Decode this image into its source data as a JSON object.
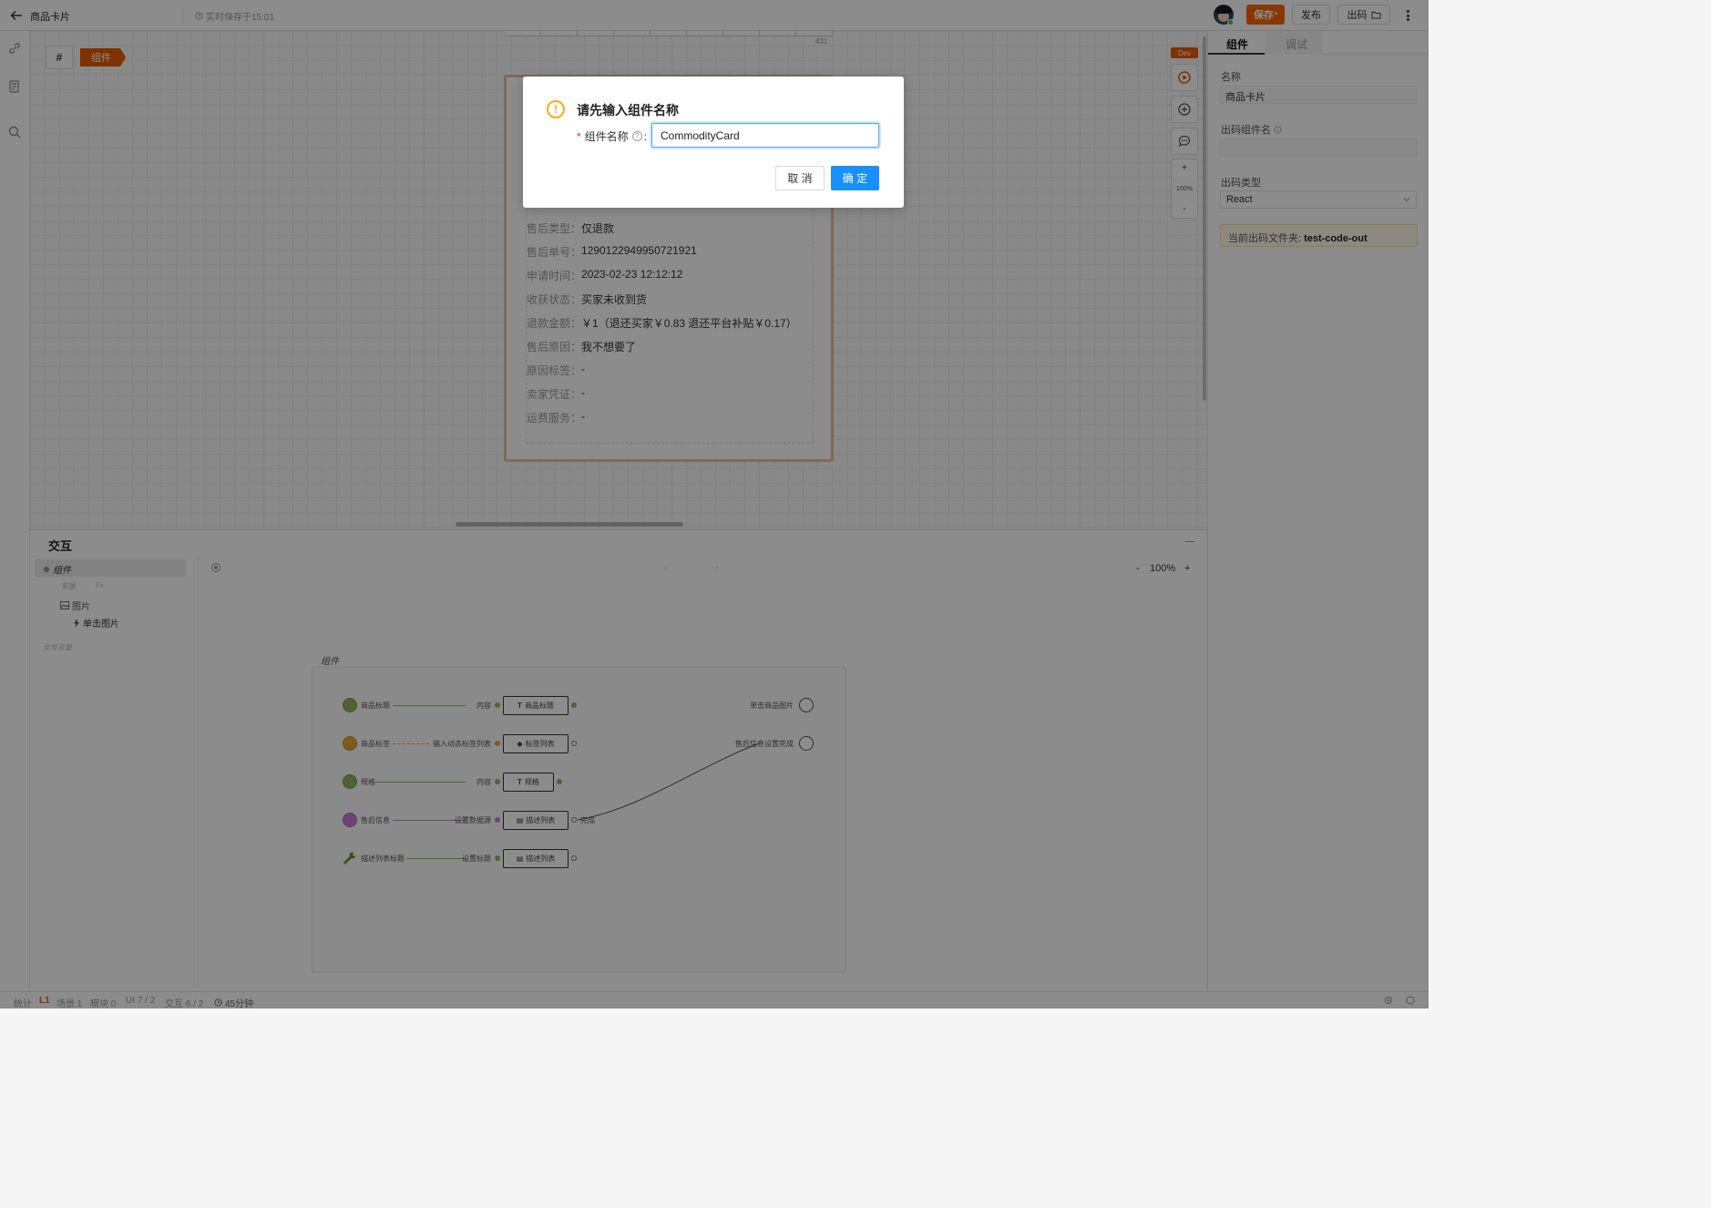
{
  "topbar": {
    "title": "商品卡片",
    "save_status": "实时保存于15:01",
    "save_label": "保存",
    "save_mark": "*",
    "publish_label": "发布",
    "code_label": "出码"
  },
  "canvas": {
    "hash_label": "#",
    "component_tag": "组件",
    "ruler_number": "431",
    "dev_badge": "Dev",
    "zoom_plus": "+",
    "zoom_level": "100%",
    "zoom_minus": "-",
    "descriptions": [
      {
        "key": "售后类型：",
        "value": "仅退款"
      },
      {
        "key": "售后单号：",
        "value": "1290122949950721921"
      },
      {
        "key": "申请时间：",
        "value": "2023-02-23 12:12:12"
      },
      {
        "key": "收获状态：",
        "value": "买家未收到货"
      },
      {
        "key": "退款金额：",
        "value": "￥1（退还买家￥0.83 退还平台补贴￥0.17）"
      },
      {
        "key": "售后原因：",
        "value": "我不想要了"
      },
      {
        "key": "原因标签：",
        "value": "-"
      },
      {
        "key": "卖家凭证：",
        "value": "-"
      },
      {
        "key": "运费服务：",
        "value": "-"
      }
    ]
  },
  "right_panel": {
    "tabs": [
      "组件",
      "调试"
    ],
    "name_label": "名称",
    "name_value": "商品卡片",
    "code_name_label": "出码组件名",
    "code_name_value": "",
    "code_type_label": "出码类型",
    "code_type_value": "React",
    "notice_prefix": "当前出码文件夹: ",
    "notice_folder": "test-code-out"
  },
  "interaction": {
    "title": "交互",
    "tree": {
      "root": "组件",
      "sub1": "变量",
      "sub2": "Fx",
      "image": "图片",
      "click": "单击图片",
      "global": "全局变量"
    },
    "nav": "← →",
    "zoom_minus": "-",
    "zoom_level": "100%",
    "zoom_plus": "+",
    "frame_label": "组件",
    "graph": {
      "inputs": [
        "商品标题",
        "商品标签",
        "规格",
        "售后信息",
        "描述列表标题"
      ],
      "port_labels": [
        "内容",
        "输入动态标签列表",
        "内容",
        "设置数据源",
        "设置标题"
      ],
      "boxes": [
        "商品标题",
        "标签列表",
        "规格",
        "描述列表",
        "描述列表"
      ],
      "done_label": "完成",
      "outputs": [
        "单击商品图片",
        "售后信息设置完成"
      ]
    }
  },
  "statusbar": {
    "stats": "统计",
    "level": "L1",
    "scene": "场景 1",
    "module": "模块 0",
    "ui": "UI 7 / 2",
    "interact": "交互 6 / 2",
    "time": "45分钟"
  },
  "modal": {
    "title": "请先输入组件名称",
    "field_label": "组件名称",
    "required_mark": "*",
    "help_mark": "?",
    "colon": ":",
    "field_value": "CommodityCard",
    "cancel_label": "取 消",
    "ok_label": "确 定"
  },
  "colors": {
    "accent_orange": "#fa6400",
    "primary_blue": "#1890ff",
    "warning_yellow": "#faad14",
    "purple_node": "#c77dd6",
    "green_node": "#8bb561",
    "orange_node": "#e6a43a"
  }
}
